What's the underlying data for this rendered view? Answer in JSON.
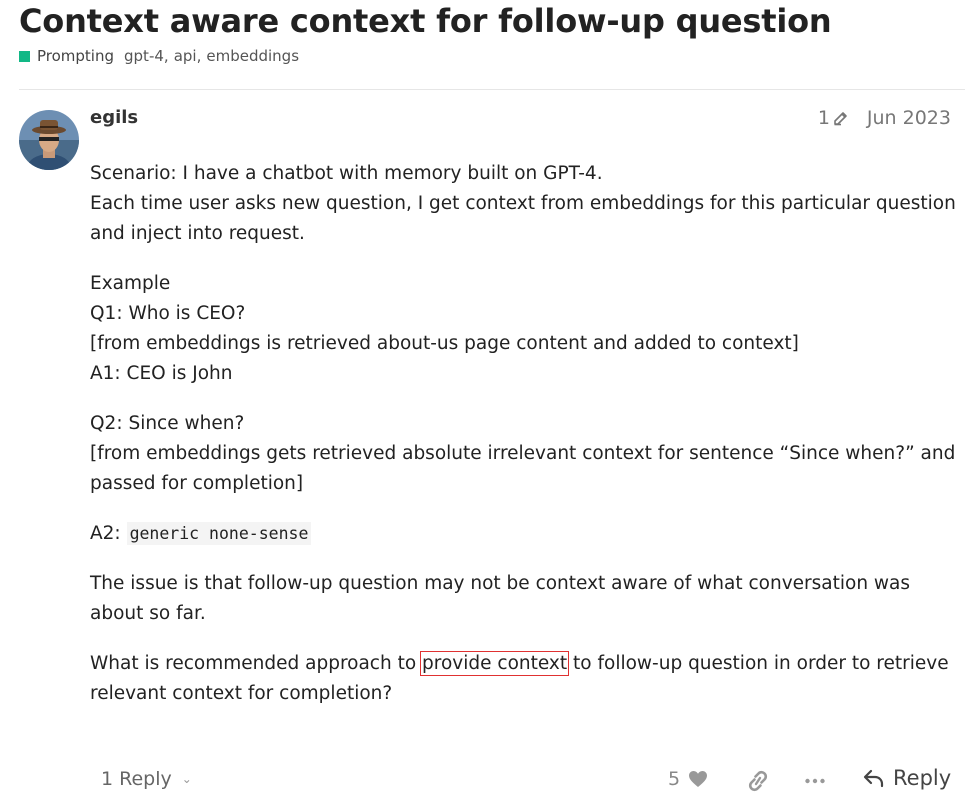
{
  "topic": {
    "title": "Context aware context for follow-up question",
    "category": {
      "label": "Prompting",
      "color": "#12b886"
    },
    "tags": [
      "gpt-4",
      "api",
      "embeddings"
    ]
  },
  "post": {
    "username": "egils",
    "edit_count": "1",
    "date": "Jun 2023",
    "paragraphs": [
      [
        "Scenario: I have a chatbot with memory built on GPT-4.",
        "Each time user asks new question, I get context from embeddings for this particular question",
        "and inject into request."
      ],
      [
        "Example",
        "Q1: Who is CEO?",
        "[from embeddings is retrieved about-us page content and added to context]",
        "A1: CEO is John"
      ],
      [
        "Q2: Since when?",
        "[from embeddings gets retrieved absolute irrelevant context for sentence “Since when?” and",
        "passed for completion]"
      ]
    ],
    "a2_label": "A2:",
    "a2_code": "generic none-sense",
    "issue_lines": [
      "The issue is that follow-up question may not be context aware of what conversation was",
      "about so far."
    ],
    "question": {
      "before": "What is recommended approach to",
      "highlighted": "provide context",
      "after": "to follow-up question in order to retrieve",
      "line2": "relevant context for completion?"
    }
  },
  "actions": {
    "replies_label": "1 Reply",
    "like_count": "5",
    "reply_label": "Reply"
  },
  "icons": {
    "edit": "pencil-edit-icon",
    "like": "heart-icon",
    "link": "link-icon",
    "more": "ellipsis-icon",
    "reply": "reply-arrow-icon",
    "chevron": "chevron-down-icon"
  },
  "colors": {
    "category": "#12b886",
    "highlight_border": "#e03131"
  }
}
